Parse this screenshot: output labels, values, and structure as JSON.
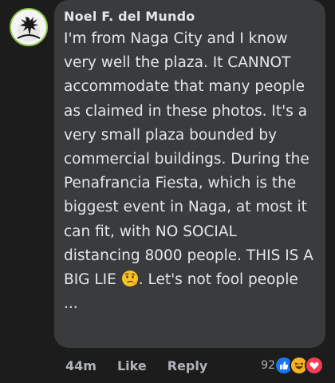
{
  "comment": {
    "author": "Noel F. del Mundo",
    "text": "I'm from Naga City and I know very well the plaza. It CANNOT accommodate that many people as claimed in these photos. It's a very small plaza bounded by commercial buildings. During the Penafrancia Fiesta, which is the biggest event in Naga, at most it can fit, with NO SOCIAL distancing 8000 people. THIS IS A BIG LIE",
    "text_after_emoji": "Let's not fool people ...",
    "inline_emoji": "thinking-face-emoji"
  },
  "actions": {
    "time": "44m",
    "like_label": "Like",
    "reply_label": "Reply"
  },
  "reactions": {
    "count": "92",
    "icons": [
      "like-reaction-icon",
      "haha-reaction-icon",
      "love-reaction-icon"
    ]
  },
  "colors": {
    "background": "#1c1c1c",
    "bubble": "#3a3b3c",
    "text": "#e4e6eb",
    "muted": "#b0b3b8",
    "like_blue": "#1877f2",
    "love_red": "#f33e58",
    "haha_yellow": "#f7b125"
  }
}
